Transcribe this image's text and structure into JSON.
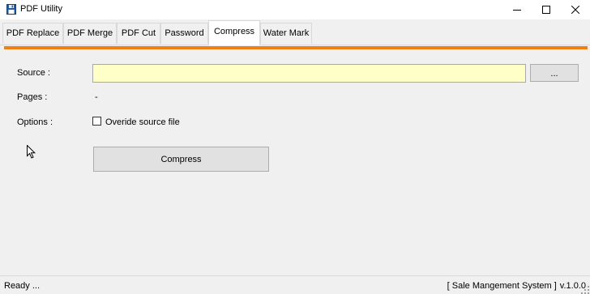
{
  "window": {
    "title": "PDF Utility",
    "icon": "floppy-disk-icon",
    "controls": [
      "minimize-icon",
      "maximize-icon",
      "close-icon"
    ]
  },
  "tabs": [
    {
      "label": "PDF Replace",
      "active": false
    },
    {
      "label": "PDF Merge",
      "active": false
    },
    {
      "label": "PDF Cut",
      "active": false
    },
    {
      "label": "Password",
      "active": false
    },
    {
      "label": "Compress",
      "active": true
    },
    {
      "label": "Water Mark",
      "active": false
    }
  ],
  "colors": {
    "accent_bar": "#f07f15",
    "source_field_bg": "#ffffc8"
  },
  "form": {
    "source_label": "Source :",
    "source_value": "",
    "browse_label": "...",
    "pages_label": "Pages :",
    "pages_value": "-",
    "options_label": "Options :",
    "override_label": "Overide source file",
    "override_checked": false,
    "compress_label": "Compress"
  },
  "status": {
    "left": "Ready ...",
    "system": "[ Sale Mangement System ]",
    "version": "v.1.0.0"
  }
}
